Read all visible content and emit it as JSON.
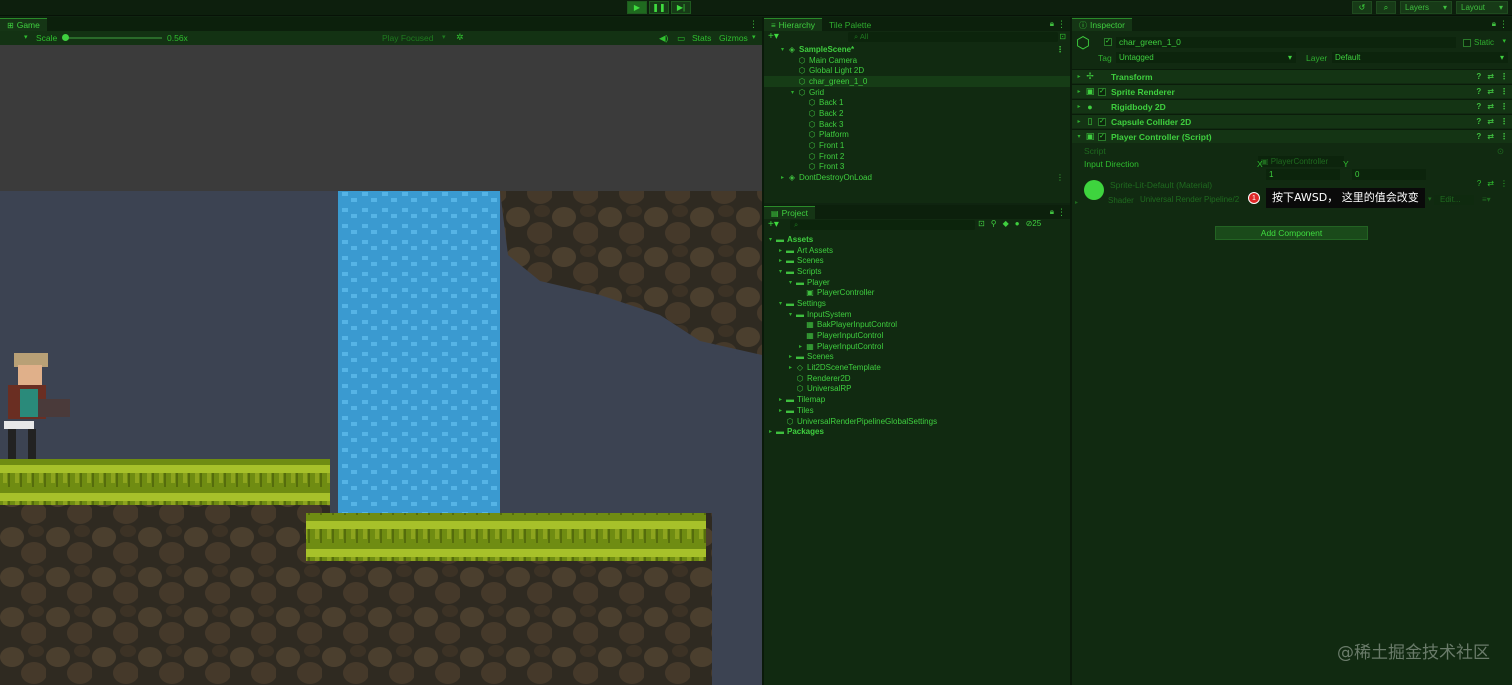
{
  "toolbar": {
    "play": "▶",
    "pause": "❚❚",
    "step": "▶|",
    "history_icon": "history-icon",
    "search_icon": "search-icon",
    "layers_label": "Layers",
    "layout_label": "Layout"
  },
  "game": {
    "tab_label": "Game",
    "scale_label": "Scale",
    "scale_value": "0.56x",
    "scale_fraction": 0.0,
    "play_focused_label": "Play Focused",
    "stats_label": "Stats",
    "gizmos_label": "Gizmos"
  },
  "hierarchy": {
    "tab_label": "Hierarchy",
    "tab2_label": "Tile Palette",
    "search_placeholder": "All",
    "items": [
      {
        "label": "SampleScene*",
        "depth": 0,
        "expanded": true,
        "bold": true,
        "icon": "scene-icon"
      },
      {
        "label": "Main Camera",
        "depth": 1,
        "icon": "gameobject-icon"
      },
      {
        "label": "Global Light 2D",
        "depth": 1,
        "icon": "gameobject-icon"
      },
      {
        "label": "char_green_1_0",
        "depth": 1,
        "icon": "gameobject-icon",
        "selected": true
      },
      {
        "label": "Grid",
        "depth": 1,
        "expanded": true,
        "icon": "gameobject-icon"
      },
      {
        "label": "Back 1",
        "depth": 2,
        "icon": "gameobject-icon"
      },
      {
        "label": "Back 2",
        "depth": 2,
        "icon": "gameobject-icon"
      },
      {
        "label": "Back 3",
        "depth": 2,
        "icon": "gameobject-icon"
      },
      {
        "label": "Platform",
        "depth": 2,
        "icon": "gameobject-icon"
      },
      {
        "label": "Front 1",
        "depth": 2,
        "icon": "gameobject-icon"
      },
      {
        "label": "Front 2",
        "depth": 2,
        "icon": "gameobject-icon"
      },
      {
        "label": "Front 3",
        "depth": 2,
        "icon": "gameobject-icon"
      },
      {
        "label": "DontDestroyOnLoad",
        "depth": 0,
        "collapsed": true,
        "icon": "scene-icon"
      }
    ]
  },
  "project": {
    "tab_label": "Project",
    "badge_count": "25",
    "items": [
      {
        "label": "Assets",
        "depth": 0,
        "expanded": true,
        "bold": true,
        "icon": "folder-icon"
      },
      {
        "label": "Art Assets",
        "depth": 1,
        "collapsed": true,
        "icon": "folder-icon"
      },
      {
        "label": "Scenes",
        "depth": 1,
        "collapsed": true,
        "icon": "folder-icon"
      },
      {
        "label": "Scripts",
        "depth": 1,
        "expanded": true,
        "icon": "folder-icon"
      },
      {
        "label": "Player",
        "depth": 2,
        "expanded": true,
        "icon": "folder-icon"
      },
      {
        "label": "PlayerController",
        "depth": 3,
        "icon": "script-icon"
      },
      {
        "label": "Settings",
        "depth": 1,
        "expanded": true,
        "icon": "folder-icon"
      },
      {
        "label": "InputSystem",
        "depth": 2,
        "expanded": true,
        "icon": "folder-icon"
      },
      {
        "label": "BakPlayerInputControl",
        "depth": 3,
        "icon": "input-asset-icon"
      },
      {
        "label": "PlayerInputControl",
        "depth": 3,
        "icon": "input-asset-icon"
      },
      {
        "label": "PlayerInputControl",
        "depth": 3,
        "collapsed": true,
        "icon": "input-asset-icon"
      },
      {
        "label": "Scenes",
        "depth": 2,
        "collapsed": true,
        "icon": "folder-icon"
      },
      {
        "label": "Lit2DSceneTemplate",
        "depth": 2,
        "collapsed": true,
        "icon": "template-icon"
      },
      {
        "label": "Renderer2D",
        "depth": 2,
        "icon": "asset-icon"
      },
      {
        "label": "UniversalRP",
        "depth": 2,
        "icon": "asset-icon"
      },
      {
        "label": "Tilemap",
        "depth": 1,
        "collapsed": true,
        "icon": "folder-icon"
      },
      {
        "label": "Tiles",
        "depth": 1,
        "collapsed": true,
        "icon": "folder-icon"
      },
      {
        "label": "UniversalRenderPipelineGlobalSettings",
        "depth": 1,
        "icon": "asset-icon"
      },
      {
        "label": "Packages",
        "depth": 0,
        "collapsed": true,
        "bold": true,
        "icon": "folder-icon"
      }
    ]
  },
  "inspector": {
    "tab_label": "Inspector",
    "object_name": "char_green_1_0",
    "static_label": "Static",
    "tag_label": "Tag",
    "tag_value": "Untagged",
    "layer_label": "Layer",
    "layer_value": "Default",
    "components": [
      {
        "label": "Transform",
        "icon": "transform-icon",
        "has_check": false
      },
      {
        "label": "Sprite Renderer",
        "icon": "sprite-renderer-icon",
        "has_check": true
      },
      {
        "label": "Rigidbody 2D",
        "icon": "rigidbody-icon",
        "has_check": false
      },
      {
        "label": "Capsule Collider 2D",
        "icon": "collider-icon",
        "has_check": true
      },
      {
        "label": "Player Controller (Script)",
        "icon": "script-icon",
        "has_check": true
      }
    ],
    "script_label": "Script",
    "script_value": "PlayerController",
    "input_direction_label": "Input Direction",
    "x_label": "X",
    "x_value": "1",
    "y_label": "Y",
    "y_value": "0",
    "material_name": "Sprite-Lit-Default (Material)",
    "shader_label": "Shader",
    "shader_value": "Universal Render Pipeline/2",
    "edit_label": "Edit...",
    "badge_number": "1",
    "callout_text": "按下AWSD，  这里的值会改变",
    "add_component_label": "Add Component"
  },
  "watermark": "@稀土掘金技术社区",
  "colors": {
    "accent": "#3fcf3f",
    "panel_bg": "#112a11",
    "sky": "#3c4352",
    "water": "#3fa3d8",
    "grass": "#8ca31e",
    "rock": "#4a3f30"
  }
}
